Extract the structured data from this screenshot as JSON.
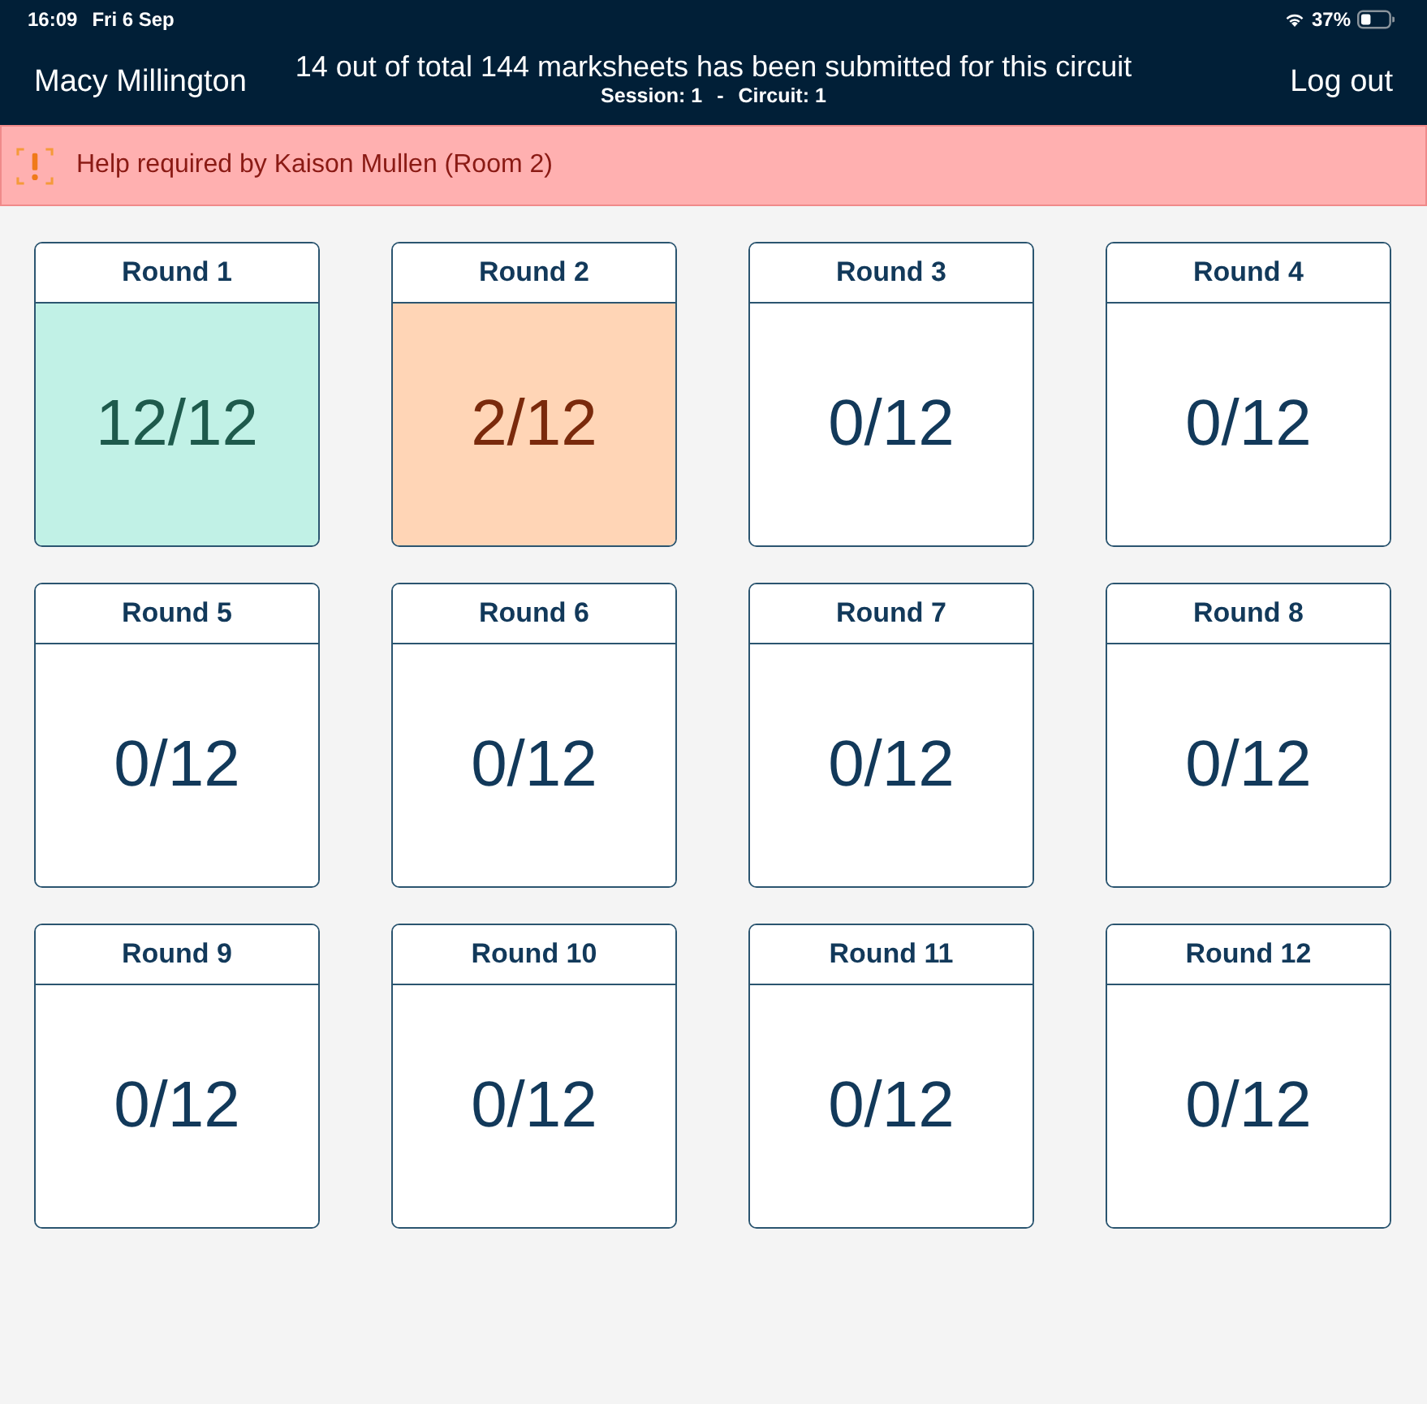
{
  "status_bar": {
    "time": "16:09",
    "date": "Fri 6 Sep",
    "battery": "37%"
  },
  "header": {
    "user": "Macy Millington",
    "title": "14 out of total 144 marksheets has been submitted for this circuit",
    "session": "Session: 1",
    "separator": "-",
    "circuit": "Circuit: 1",
    "logout": "Log out"
  },
  "alert": {
    "message": "Help required by Kaison Mullen (Room 2)"
  },
  "rounds": [
    {
      "label": "Round 1",
      "count": "12/12",
      "kind": "complete"
    },
    {
      "label": "Round 2",
      "count": "2/12",
      "kind": "partial"
    },
    {
      "label": "Round 3",
      "count": "0/12",
      "kind": "empty"
    },
    {
      "label": "Round 4",
      "count": "0/12",
      "kind": "empty"
    },
    {
      "label": "Round 5",
      "count": "0/12",
      "kind": "empty"
    },
    {
      "label": "Round 6",
      "count": "0/12",
      "kind": "empty"
    },
    {
      "label": "Round 7",
      "count": "0/12",
      "kind": "empty"
    },
    {
      "label": "Round 8",
      "count": "0/12",
      "kind": "empty"
    },
    {
      "label": "Round 9",
      "count": "0/12",
      "kind": "empty"
    },
    {
      "label": "Round 10",
      "count": "0/12",
      "kind": "empty"
    },
    {
      "label": "Round 11",
      "count": "0/12",
      "kind": "empty"
    },
    {
      "label": "Round 12",
      "count": "0/12",
      "kind": "empty"
    }
  ]
}
